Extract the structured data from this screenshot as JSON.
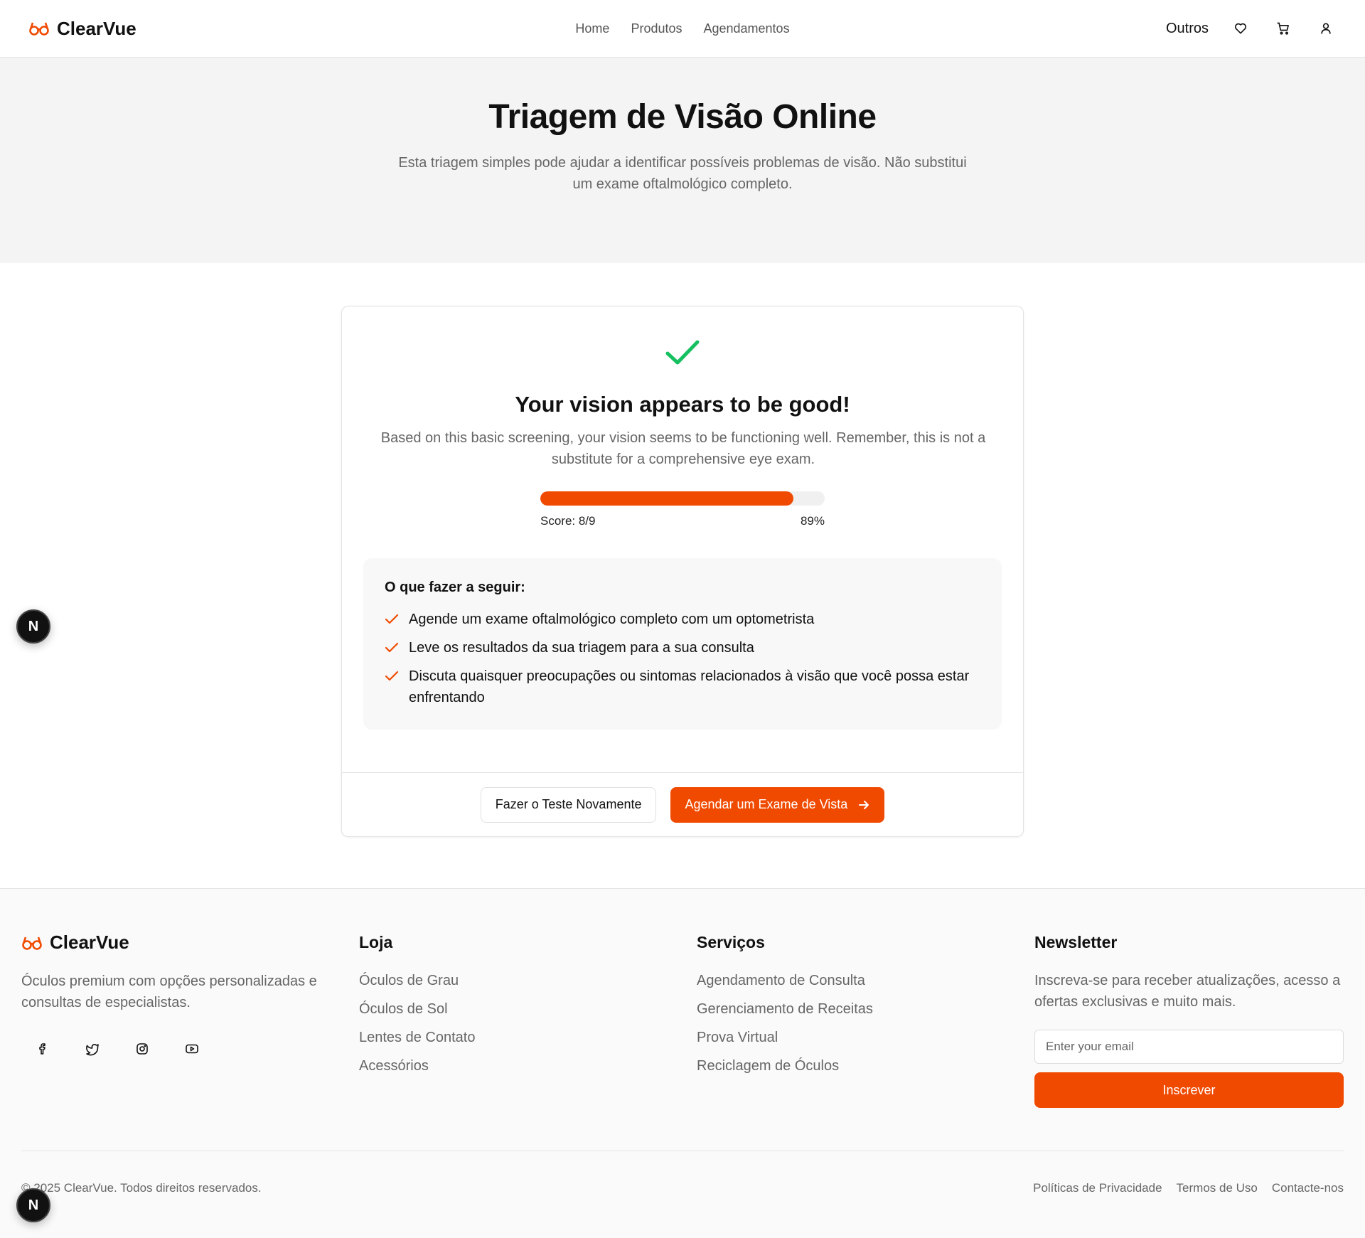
{
  "header": {
    "brand": "ClearVue",
    "nav": [
      "Home",
      "Produtos",
      "Agendamentos"
    ],
    "outros": "Outros"
  },
  "hero": {
    "title": "Triagem de Visão Online",
    "subtitle": "Esta triagem simples pode ajudar a identificar possíveis problemas de visão. Não substitui um exame oftalmológico completo."
  },
  "result": {
    "title": "Your vision appears to be good!",
    "description": "Based on this basic screening, your vision seems to be functioning well. Remember, this is not a substitute for a comprehensive eye exam.",
    "score_label": "Score: 8/9",
    "percent_label": "89%",
    "progress": 0.89,
    "next_title": "O que fazer a seguir:",
    "next_steps": [
      "Agende um exame oftalmológico completo com um optometrista",
      "Leve os resultados da sua triagem para a sua consulta",
      "Discuta quaisquer preocupações ou sintomas relacionados à visão que você possa estar enfrentando"
    ],
    "retry_button": "Fazer o Teste Novamente",
    "schedule_button": "Agendar um Exame de Vista"
  },
  "footer": {
    "brand": "ClearVue",
    "description": "Óculos premium com opções personalizadas e consultas de especialistas.",
    "shop_title": "Loja",
    "shop_links": [
      "Óculos de Grau",
      "Óculos de Sol",
      "Lentes de Contato",
      "Acessórios"
    ],
    "services_title": "Serviços",
    "services_links": [
      "Agendamento de Consulta",
      "Gerenciamento de Receitas",
      "Prova Virtual",
      "Reciclagem de Óculos"
    ],
    "newsletter_title": "Newsletter",
    "newsletter_desc": "Inscreva-se para receber atualizações, acesso a ofertas exclusivas e muito mais.",
    "email_placeholder": "Enter your email",
    "subscribe_button": "Inscrever",
    "copyright": "© 2025 ClearVue. Todos direitos reservados.",
    "legal_links": [
      "Políticas de Privacidade",
      "Termos de Uso",
      "Contacte-nos"
    ]
  },
  "badge": "N",
  "colors": {
    "accent": "#f04a00",
    "success": "#16c060"
  }
}
